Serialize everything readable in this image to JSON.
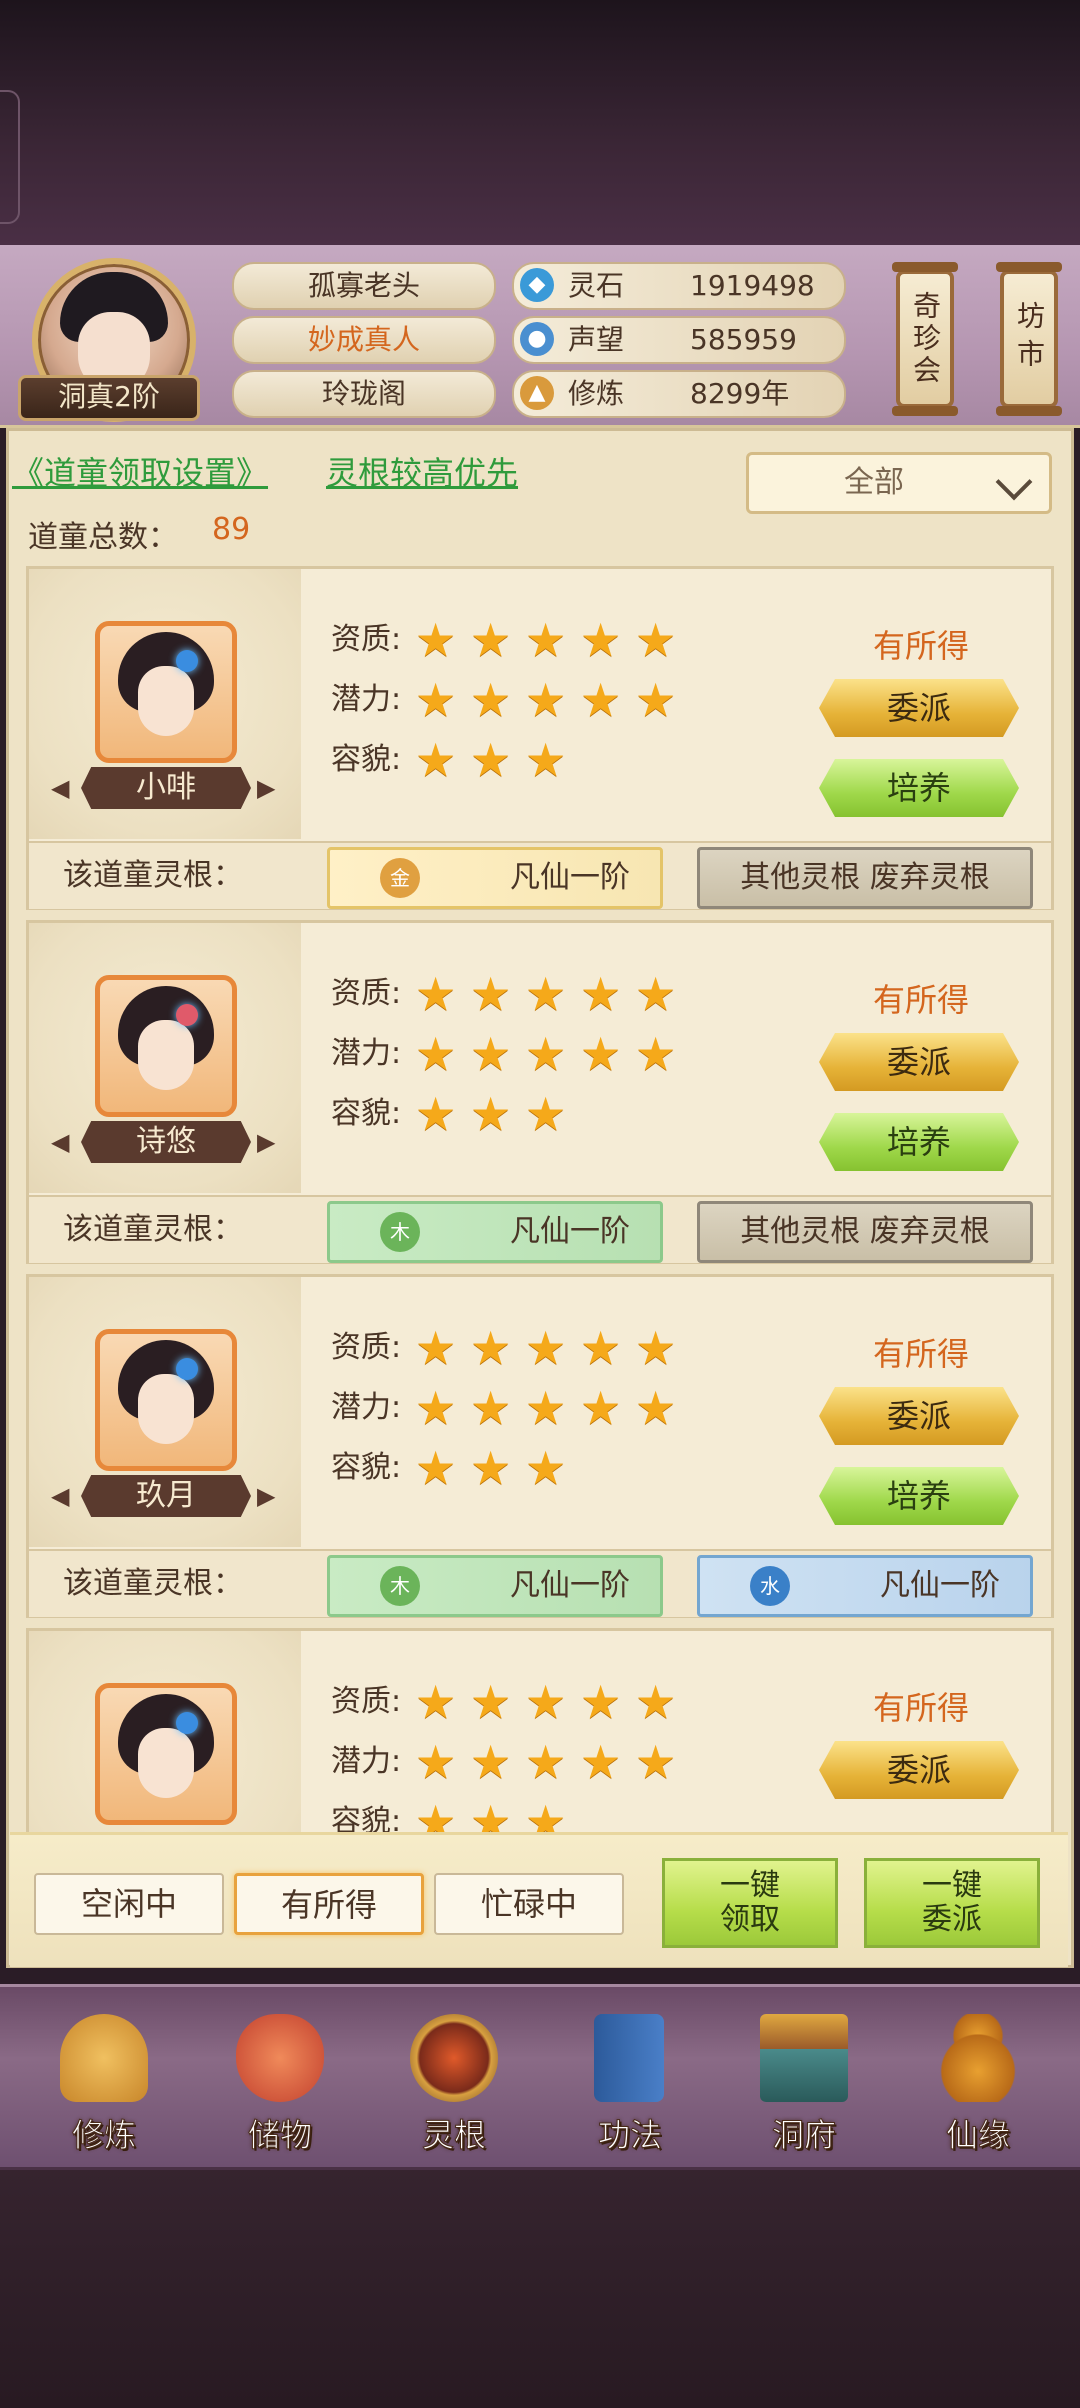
{
  "player": {
    "rank": "洞真2阶",
    "name": "孤寡老头",
    "title": "妙成真人",
    "sect": "玲珑阁"
  },
  "stats": [
    {
      "icon": "spirit-stone-icon",
      "label": "灵石",
      "value": "1919498"
    },
    {
      "icon": "reputation-icon",
      "label": "声望",
      "value": "585959"
    },
    {
      "icon": "cultivation-icon",
      "label": "修炼",
      "value": "8299年"
    }
  ],
  "shortcuts": {
    "treasure_fair": "奇珍会",
    "market": "坊市"
  },
  "settings": {
    "collect_link": "《道童领取设置》",
    "priority_link": "灵根较高优先",
    "total_label": "道童总数：",
    "total_value": "89",
    "filter_value": "全部"
  },
  "labels": {
    "aptitude": "资质:",
    "potential": "潜力:",
    "appearance": "容貌:",
    "root_label": "该道童灵根："
  },
  "children": [
    {
      "name": "小啡",
      "status": "有所得",
      "assign": "委派",
      "train": "培养",
      "aptitude": 5,
      "potential": 5,
      "appearance": 3,
      "roots": [
        {
          "elem": "金",
          "text": "凡仙一阶",
          "style": "gold"
        },
        {
          "elem": "",
          "text": "其他灵根 废弃灵根",
          "style": "grey"
        }
      ]
    },
    {
      "name": "诗悠",
      "status": "有所得",
      "assign": "委派",
      "train": "培养",
      "aptitude": 5,
      "potential": 5,
      "appearance": 3,
      "roots": [
        {
          "elem": "木",
          "text": "凡仙一阶",
          "style": "green"
        },
        {
          "elem": "",
          "text": "其他灵根 废弃灵根",
          "style": "grey"
        }
      ]
    },
    {
      "name": "玖月",
      "status": "有所得",
      "assign": "委派",
      "train": "培养",
      "aptitude": 5,
      "potential": 5,
      "appearance": 3,
      "roots": [
        {
          "elem": "木",
          "text": "凡仙一阶",
          "style": "green"
        },
        {
          "elem": "水",
          "text": "凡仙一阶",
          "style": "blue"
        }
      ]
    },
    {
      "name": "",
      "status": "有所得",
      "assign": "委派",
      "train": "",
      "aptitude": 5,
      "potential": 5,
      "appearance": 3,
      "roots": []
    }
  ],
  "tabs": [
    "空闲中",
    "有所得",
    "忙碌中"
  ],
  "active_tab": 1,
  "bulk_actions": {
    "collect": [
      "一键",
      "领取"
    ],
    "assign": [
      "一键",
      "委派"
    ]
  },
  "nav": [
    {
      "icon": "monk-icon",
      "label": "修炼"
    },
    {
      "icon": "bag-icon",
      "label": "储物"
    },
    {
      "icon": "spirit-root-icon",
      "label": "灵根"
    },
    {
      "icon": "book-icon",
      "label": "功法"
    },
    {
      "icon": "mansion-icon",
      "label": "洞府"
    },
    {
      "icon": "gourd-icon",
      "label": "仙缘"
    }
  ],
  "colors": {
    "accent_orange": "#d4661e",
    "link_green": "#2f9b3c",
    "star": "#f5a91a"
  }
}
